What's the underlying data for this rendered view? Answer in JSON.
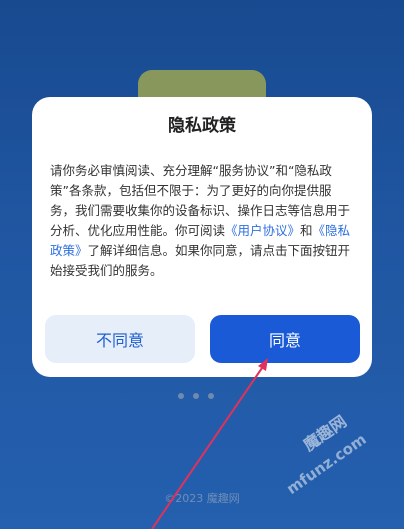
{
  "dialog": {
    "title": "隐私政策",
    "body_1": "请你务必审慎阅读、充分理解“服务协议”和“隐私政策”各条款，包括但不限于：为了更好的向你提供服务，我们需要收集你的设备标识、操作日志等信息用于分析、优化应用性能。你可阅读",
    "link_user_agreement": "《用户协议》",
    "and": "和",
    "link_privacy_policy": "《隐私政策》",
    "body_2": "了解详细信息。如果你同意，请点击下面按钮开始接受我们的服务。",
    "disagree_label": "不同意",
    "agree_label": "同意"
  },
  "background": {
    "footer": "©2023 魔趣网"
  },
  "watermark": {
    "site_cn": "魔趣网",
    "site_en": "mfunz.com"
  },
  "colors": {
    "accent": "#1a5ad6",
    "link": "#2d6fe0",
    "arrow": "#e0325a"
  }
}
